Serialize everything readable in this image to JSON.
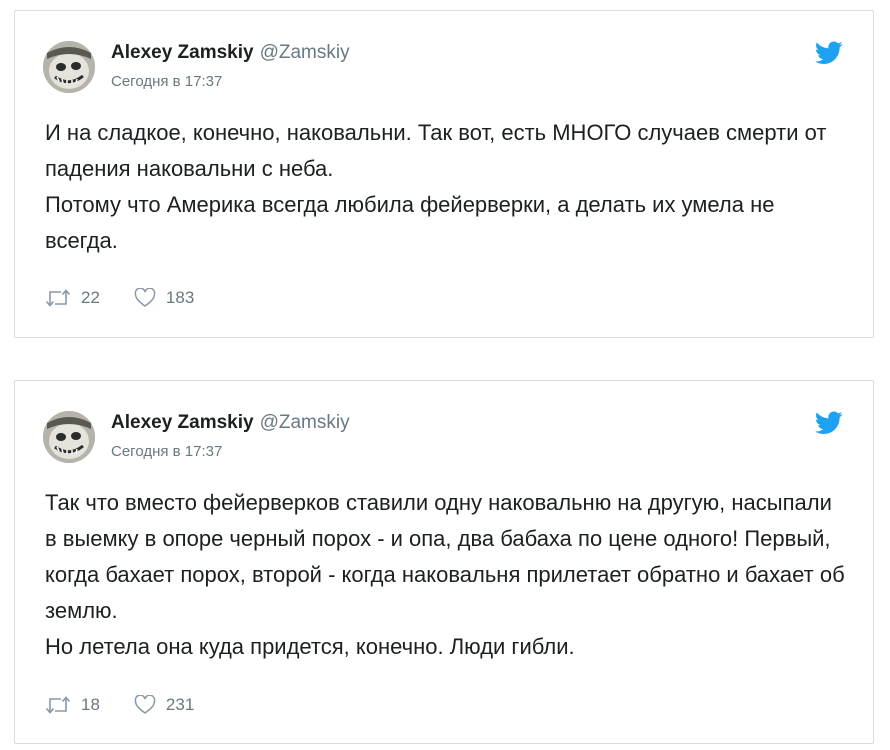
{
  "colors": {
    "text": "#1c2022",
    "muted": "#697882",
    "twitter_blue": "#1da1f2",
    "border": "#dcdcdc"
  },
  "tweets": [
    {
      "author_name": "Alexey Zamskiy",
      "author_handle": "@Zamskiy",
      "timestamp": "Сегодня в 17:37",
      "lines": [
        "И на сладкое, конечно, наковальни. Так вот, есть МНОГО случаев смерти от падения наковальни с неба.",
        "Потому что Америка всегда любила фейерверки, а делать их умела не всегда."
      ],
      "retweets": "22",
      "likes": "183",
      "icons": {
        "retweet": "retweet-icon",
        "like": "heart-icon",
        "brand": "twitter-bird-icon"
      }
    },
    {
      "author_name": "Alexey Zamskiy",
      "author_handle": "@Zamskiy",
      "timestamp": "Сегодня в 17:37",
      "lines": [
        "Так что вместо фейерверков ставили одну наковальню на другую, насыпали в выемку в опоре черный порох - и опа, два бабаха по цене одного! Первый, когда бахает порох, второй - когда наковальня прилетает обратно и бахает об землю.",
        "Но летела она куда придется, конечно. Люди гибли."
      ],
      "retweets": "18",
      "likes": "231",
      "icons": {
        "retweet": "retweet-icon",
        "like": "heart-icon",
        "brand": "twitter-bird-icon"
      }
    }
  ]
}
